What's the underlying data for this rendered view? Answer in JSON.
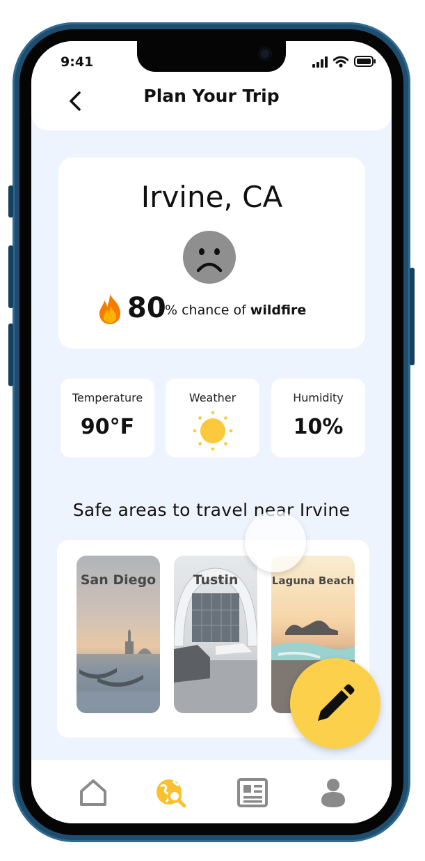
{
  "status_bar": {
    "time": "9:41"
  },
  "header": {
    "title": "Plan Your Trip",
    "back_icon": "chevron-left-icon"
  },
  "location": {
    "city": "Irvine, CA",
    "mood_icon": "sad-face-icon",
    "risk": {
      "icon": "fire-icon",
      "value": "80",
      "text_prefix": "% chance of ",
      "text_bold": "wildfire"
    }
  },
  "metrics": [
    {
      "label": "Temperature",
      "value": "90°F"
    },
    {
      "label": "Weather",
      "icon": "sun-icon"
    },
    {
      "label": "Humidity",
      "value": "10%"
    }
  ],
  "safe_areas": {
    "title": "Safe areas to travel near Irvine",
    "places": [
      {
        "name": "San Diego"
      },
      {
        "name": "Tustin"
      },
      {
        "name": "Laguna Beach"
      }
    ]
  },
  "fab": {
    "icon": "pencil-icon"
  },
  "nav": [
    {
      "icon": "home-icon"
    },
    {
      "icon": "globe-search-icon",
      "active": true
    },
    {
      "icon": "news-icon"
    },
    {
      "icon": "user-icon"
    }
  ],
  "colors": {
    "accent": "#fcd04a",
    "active_nav": "#fbc02d",
    "inactive_nav": "#8a8a8a",
    "background": "#eef4fd"
  }
}
